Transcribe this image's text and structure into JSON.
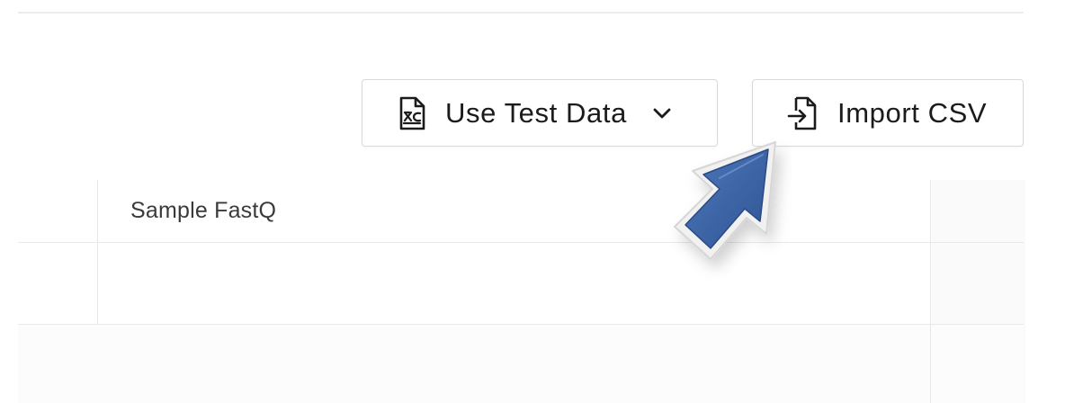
{
  "toolbar": {
    "use_test_data_label": "Use Test Data",
    "import_csv_label": "Import CSV"
  },
  "icons": {
    "use_test_data": "file-test-icon",
    "dropdown": "chevron-down-icon",
    "import_csv": "file-import-icon",
    "cursor": "mouse-pointer-icon"
  },
  "table": {
    "columns": [
      "Sample FastQ"
    ],
    "rows": []
  },
  "colors": {
    "cursor_fill": "#3c64a4",
    "cursor_outline": "#f4f4f4",
    "border": "#d9d9d9"
  }
}
